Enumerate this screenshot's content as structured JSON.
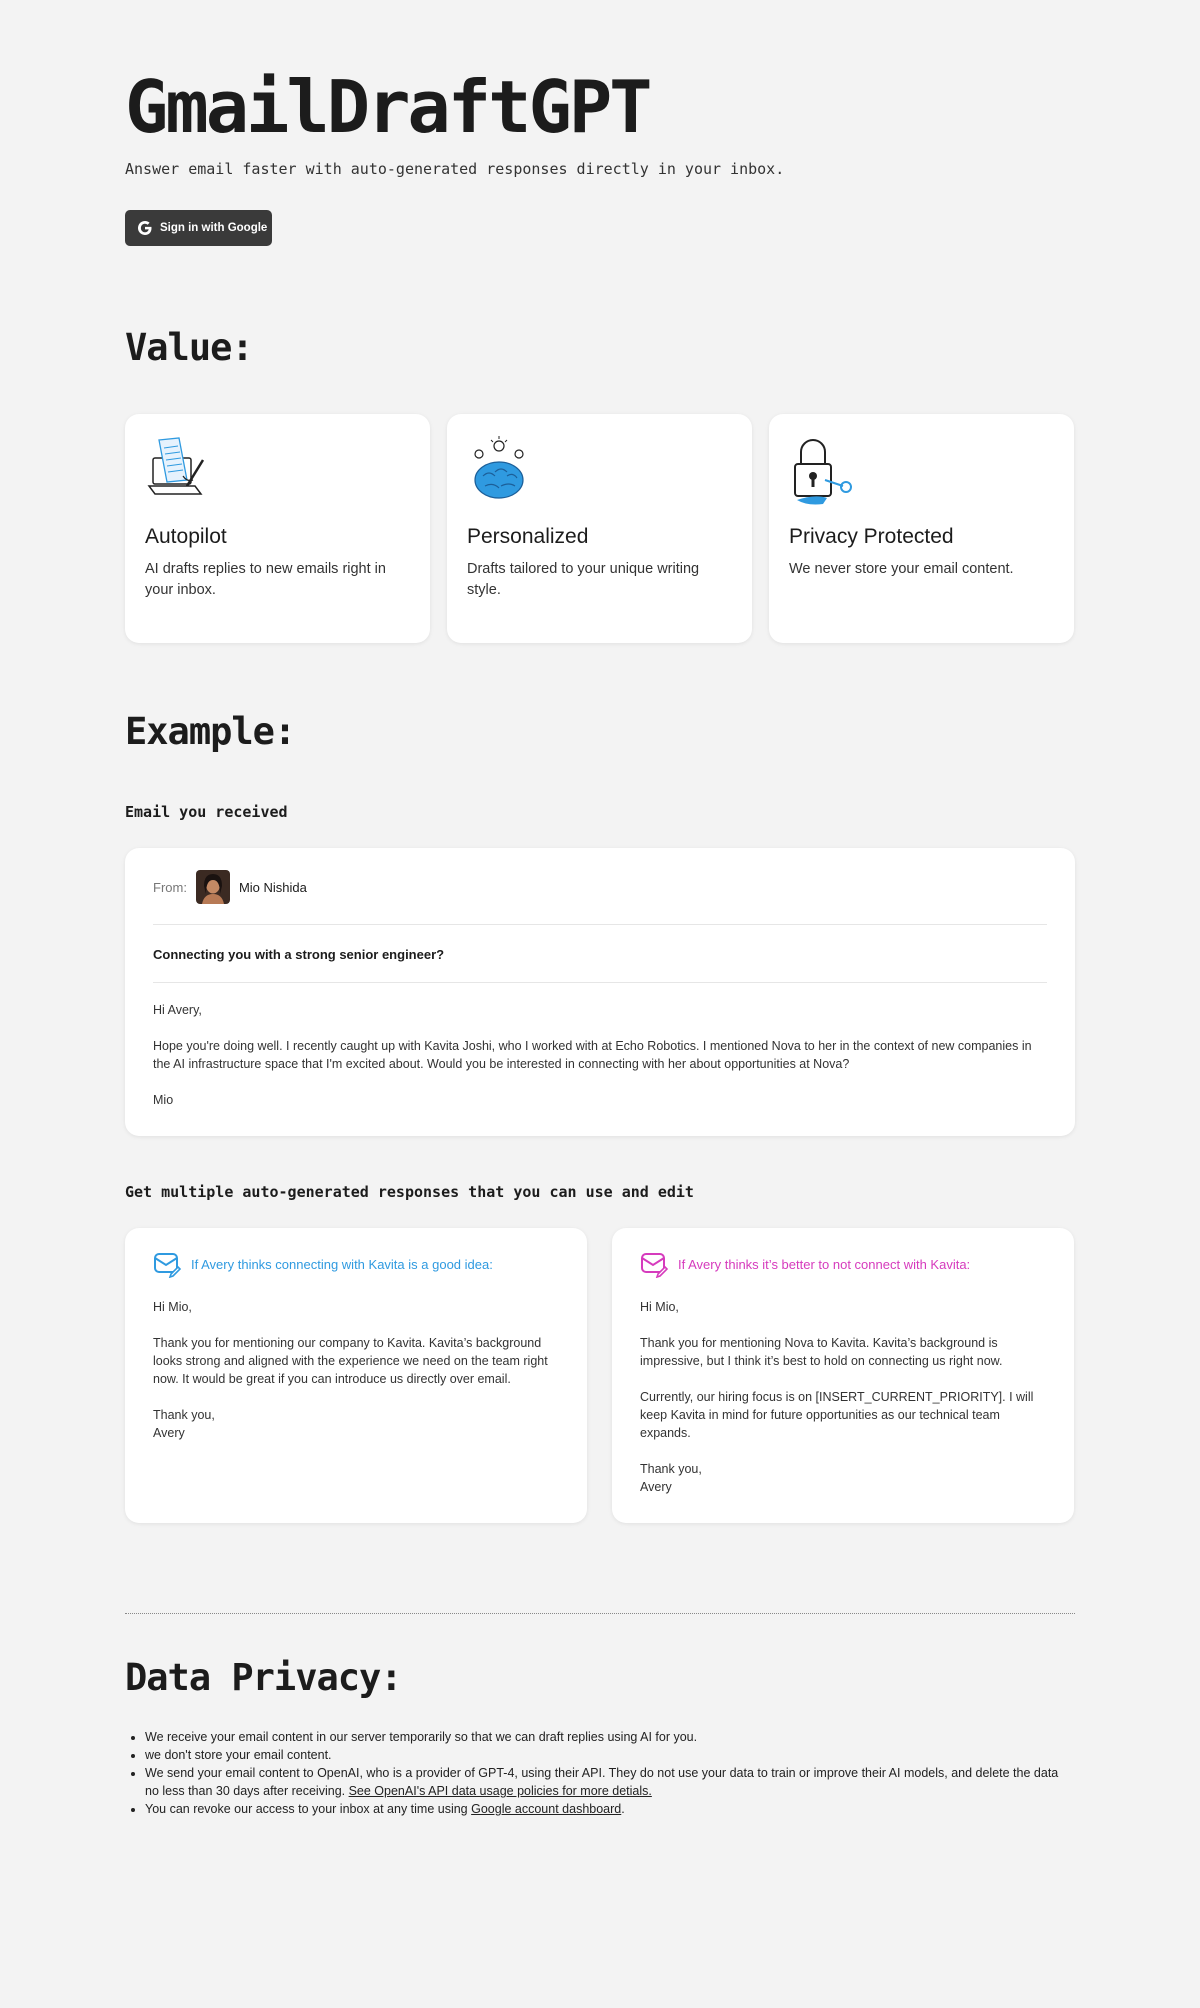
{
  "hero": {
    "title": "GmailDraftGPT",
    "subtitle": "Answer email faster with auto-generated responses directly in your inbox.",
    "signin_label": "Sign in with Google"
  },
  "value": {
    "heading": "Value:",
    "cards": [
      {
        "icon": "autopilot-illustration",
        "title": "Autopilot",
        "desc": "AI drafts replies to new emails right in your inbox."
      },
      {
        "icon": "brain-illustration",
        "title": "Personalized",
        "desc": "Drafts tailored to your unique writing style."
      },
      {
        "icon": "padlock-illustration",
        "title": "Privacy Protected",
        "desc": "We never store your email content."
      }
    ]
  },
  "example": {
    "heading": "Example:",
    "received_label": "Email you received",
    "email": {
      "from_label": "From:",
      "from_name": "Mio Nishida",
      "subject": "Connecting you with a strong senior engineer?",
      "body": [
        "Hi Avery,",
        "Hope you're doing well. I recently caught up with Kavita Joshi, who I worked with at Echo Robotics. I mentioned Nova to her in the context of new companies in the AI infrastructure space that I'm excited about. Would you be interested in connecting with her about opportunities at Nova?",
        "Mio"
      ]
    },
    "responses_label": "Get multiple auto-generated responses that you can use and edit",
    "responses": [
      {
        "color": "#2f9ae0",
        "heading": "If Avery thinks connecting with Kavita is a good idea:",
        "body": [
          "Hi Mio,",
          "Thank you for mentioning our company to Kavita. Kavita’s background looks strong and aligned with the experience we need on the team right now. It would be great if you can introduce us directly over email.",
          "Thank you,\nAvery"
        ]
      },
      {
        "color": "#d63bbd",
        "heading": "If Avery thinks it’s better to not connect with Kavita:",
        "body": [
          "Hi Mio,",
          "Thank you for mentioning Nova to Kavita. Kavita’s background is impressive, but I think it’s best to hold on connecting us right now.",
          "Currently, our hiring focus is on [INSERT_CURRENT_PRIORITY]. I will keep Kavita in mind for future opportunities as our technical team expands.",
          "Thank you,\nAvery"
        ]
      }
    ]
  },
  "privacy": {
    "heading": "Data Privacy:",
    "items": [
      {
        "text": "We receive your email content in our server temporarily so that we can draft replies using AI for you."
      },
      {
        "text": "we don't store your email content."
      },
      {
        "text": "We send your email content to OpenAI, who is a provider of GPT-4, using their API. They do not use your data to train or improve their AI models, and delete the data no less than 30 days after receiving. ",
        "link": "See OpenAI's API data usage policies for more detials.",
        "after": ""
      },
      {
        "text": "You can revoke our access to your inbox at any time using ",
        "link": "Google account dashboard",
        "after": "."
      }
    ]
  }
}
